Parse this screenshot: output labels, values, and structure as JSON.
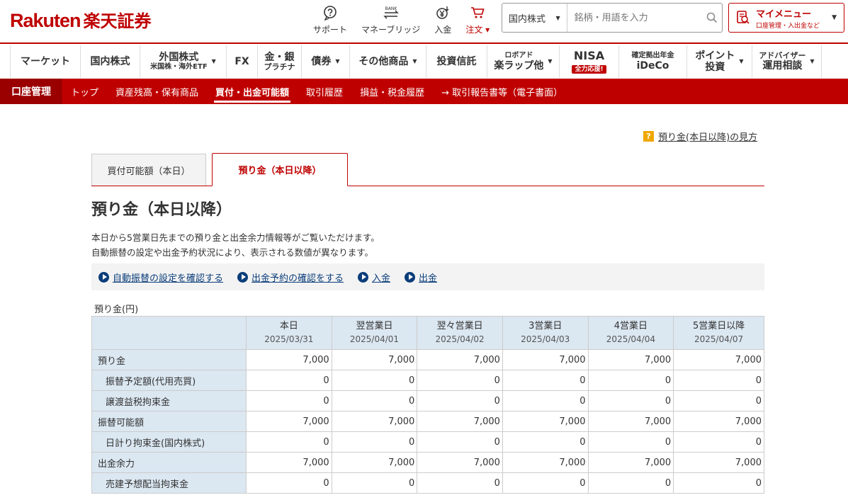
{
  "header": {
    "logo_brand": "Rakuten",
    "logo_jp": "楽天証券",
    "tools": [
      {
        "icon": "support-icon",
        "label": "サポート"
      },
      {
        "icon": "bank-transfer-icon",
        "label": "マネーブリッジ",
        "icon_text": "BANK"
      },
      {
        "icon": "deposit-yen-icon",
        "label": "入金"
      },
      {
        "icon": "cart-icon",
        "label": "注文 ▾"
      }
    ],
    "search": {
      "select_value": "国内株式",
      "placeholder": "銘柄・用語を入力"
    },
    "mymenu": {
      "title": "マイメニュー",
      "sub": "口座管理・入出金など"
    }
  },
  "global_nav": [
    {
      "label": "マーケット",
      "sub": "",
      "has_dropdown": false
    },
    {
      "label": "国内株式",
      "sub": "",
      "has_dropdown": false
    },
    {
      "label": "外国株式",
      "sub": "米国株・海外ETF",
      "has_dropdown": true
    },
    {
      "label": "FX",
      "sub": "",
      "has_dropdown": false
    },
    {
      "label": "金・銀",
      "sub": "プラチナ",
      "has_dropdown": false
    },
    {
      "label": "債券",
      "sub": "",
      "has_dropdown": true
    },
    {
      "label": "その他商品",
      "sub": "",
      "has_dropdown": true
    },
    {
      "label": "投資信託",
      "sub": "",
      "has_dropdown": false
    },
    {
      "label": "ロボアド",
      "sub": "楽ラップ他",
      "has_dropdown": true
    },
    {
      "label": "NISA",
      "sub": "全力応援!",
      "has_dropdown": false
    },
    {
      "label": "確定拠出年金",
      "sub": "iDeCo",
      "has_dropdown": false
    },
    {
      "label": "ポイント",
      "sub": "投資",
      "has_dropdown": true
    },
    {
      "label": "アドバイザー",
      "sub": "運用相談",
      "has_dropdown": true
    }
  ],
  "account_nav": {
    "title": "口座管理",
    "items": [
      {
        "label": "トップ",
        "active": false
      },
      {
        "label": "資産残高・保有商品",
        "active": false
      },
      {
        "label": "買付・出金可能額",
        "active": true
      },
      {
        "label": "取引履歴",
        "active": false
      },
      {
        "label": "損益・税金履歴",
        "active": false
      },
      {
        "label": "→ 取引報告書等（電子書面）",
        "active": false
      }
    ]
  },
  "help_link": {
    "q": "?",
    "label": "預り金(本日以降)の見方"
  },
  "tabs": [
    {
      "label": "買付可能額（本日）",
      "active": false
    },
    {
      "label": "預り金（本日以降）",
      "active": true
    }
  ],
  "page_title": "預り金（本日以降）",
  "description": [
    "本日から5営業日先までの預り金と出金余力情報等がご覧いただけます。",
    "自動振替の設定や出金予約状況により、表示される数値が異なります。"
  ],
  "quick_links": [
    "自動振替の設定を確認する",
    "出金予約の確認をする",
    "入金",
    "出金"
  ],
  "table": {
    "caption": "預り金(円)",
    "columns": [
      {
        "label": "本日",
        "date": "2025/03/31"
      },
      {
        "label": "翌営業日",
        "date": "2025/04/01"
      },
      {
        "label": "翌々営業日",
        "date": "2025/04/02"
      },
      {
        "label": "3営業日",
        "date": "2025/04/03"
      },
      {
        "label": "4営業日",
        "date": "2025/04/04"
      },
      {
        "label": "5営業日以降",
        "date": "2025/04/07"
      }
    ],
    "rows": [
      {
        "label": "預り金",
        "indent": false,
        "values": [
          "7,000",
          "7,000",
          "7,000",
          "7,000",
          "7,000",
          "7,000"
        ]
      },
      {
        "label": "振替予定額(代用売買)",
        "indent": true,
        "values": [
          "0",
          "0",
          "0",
          "0",
          "0",
          "0"
        ]
      },
      {
        "label": "譲渡益税拘束金",
        "indent": true,
        "values": [
          "0",
          "0",
          "0",
          "0",
          "0",
          "0"
        ]
      },
      {
        "label": "振替可能額",
        "indent": false,
        "values": [
          "7,000",
          "7,000",
          "7,000",
          "7,000",
          "7,000",
          "7,000"
        ]
      },
      {
        "label": "日計り拘束金(国内株式)",
        "indent": true,
        "values": [
          "0",
          "0",
          "0",
          "0",
          "0",
          "0"
        ]
      },
      {
        "label": "出金余力",
        "indent": false,
        "values": [
          "7,000",
          "7,000",
          "7,000",
          "7,000",
          "7,000",
          "7,000"
        ]
      },
      {
        "label": "売建予想配当拘束金",
        "indent": true,
        "values": [
          "0",
          "0",
          "0",
          "0",
          "0",
          "0"
        ]
      }
    ]
  },
  "colors": {
    "brand_red": "#bf0000",
    "dark_red": "#9b0000",
    "header_blue": "#dbe7f1",
    "link_blue": "#0a3d7a"
  }
}
